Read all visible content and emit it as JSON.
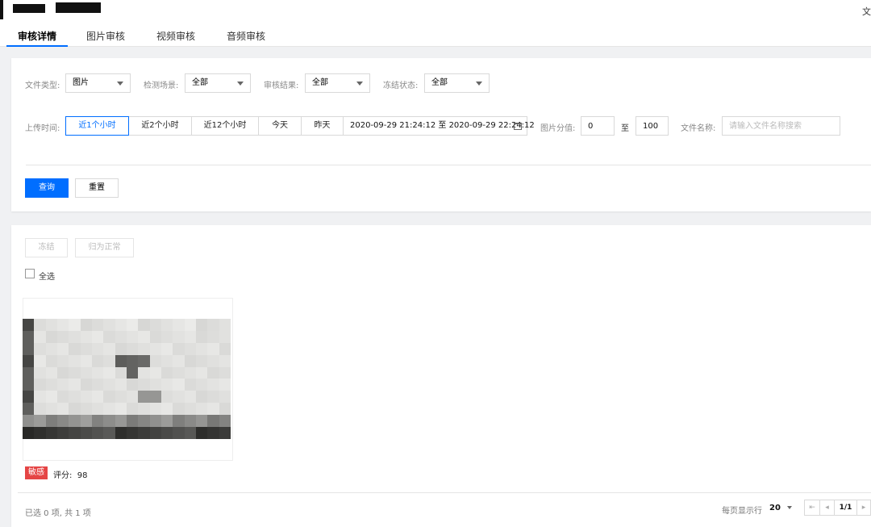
{
  "header": {
    "right_text": "文"
  },
  "tabs": [
    {
      "label": "审核详情",
      "active": true
    },
    {
      "label": "图片审核",
      "active": false
    },
    {
      "label": "视频审核",
      "active": false
    },
    {
      "label": "音频审核",
      "active": false
    }
  ],
  "filters": {
    "file_type": {
      "label": "文件类型:",
      "value": "图片"
    },
    "scene": {
      "label": "检测场景:",
      "value": "全部"
    },
    "result": {
      "label": "审核结果:",
      "value": "全部"
    },
    "freeze": {
      "label": "冻结状态:",
      "value": "全部"
    },
    "upload_time": {
      "label": "上传时间:",
      "ranges": [
        "近1个小时",
        "近2个小时",
        "近12个小时",
        "今天",
        "昨天"
      ],
      "selected": "近1个小时",
      "date_range": "2020-09-29 21:24:12 至 2020-09-29 22:24:12"
    },
    "score": {
      "label": "图片分值:",
      "min": "0",
      "sep": "至",
      "max": "100"
    },
    "file_name": {
      "label": "文件名称:",
      "placeholder": "请输入文件名称搜索"
    },
    "query_label": "查询",
    "reset_label": "重置"
  },
  "actions": {
    "freeze_label": "冻结",
    "normal_label": "归为正常",
    "select_all_label": "全选"
  },
  "results": [
    {
      "badge": "敏感",
      "score_label": "评分:",
      "score": "98"
    }
  ],
  "footer": {
    "summary": "已选 0 项, 共 1 项",
    "page_size_label": "每页显示行",
    "page_size": "20",
    "page": "1/1"
  },
  "colors": {
    "accent": "#006eff",
    "danger": "#e54545"
  }
}
